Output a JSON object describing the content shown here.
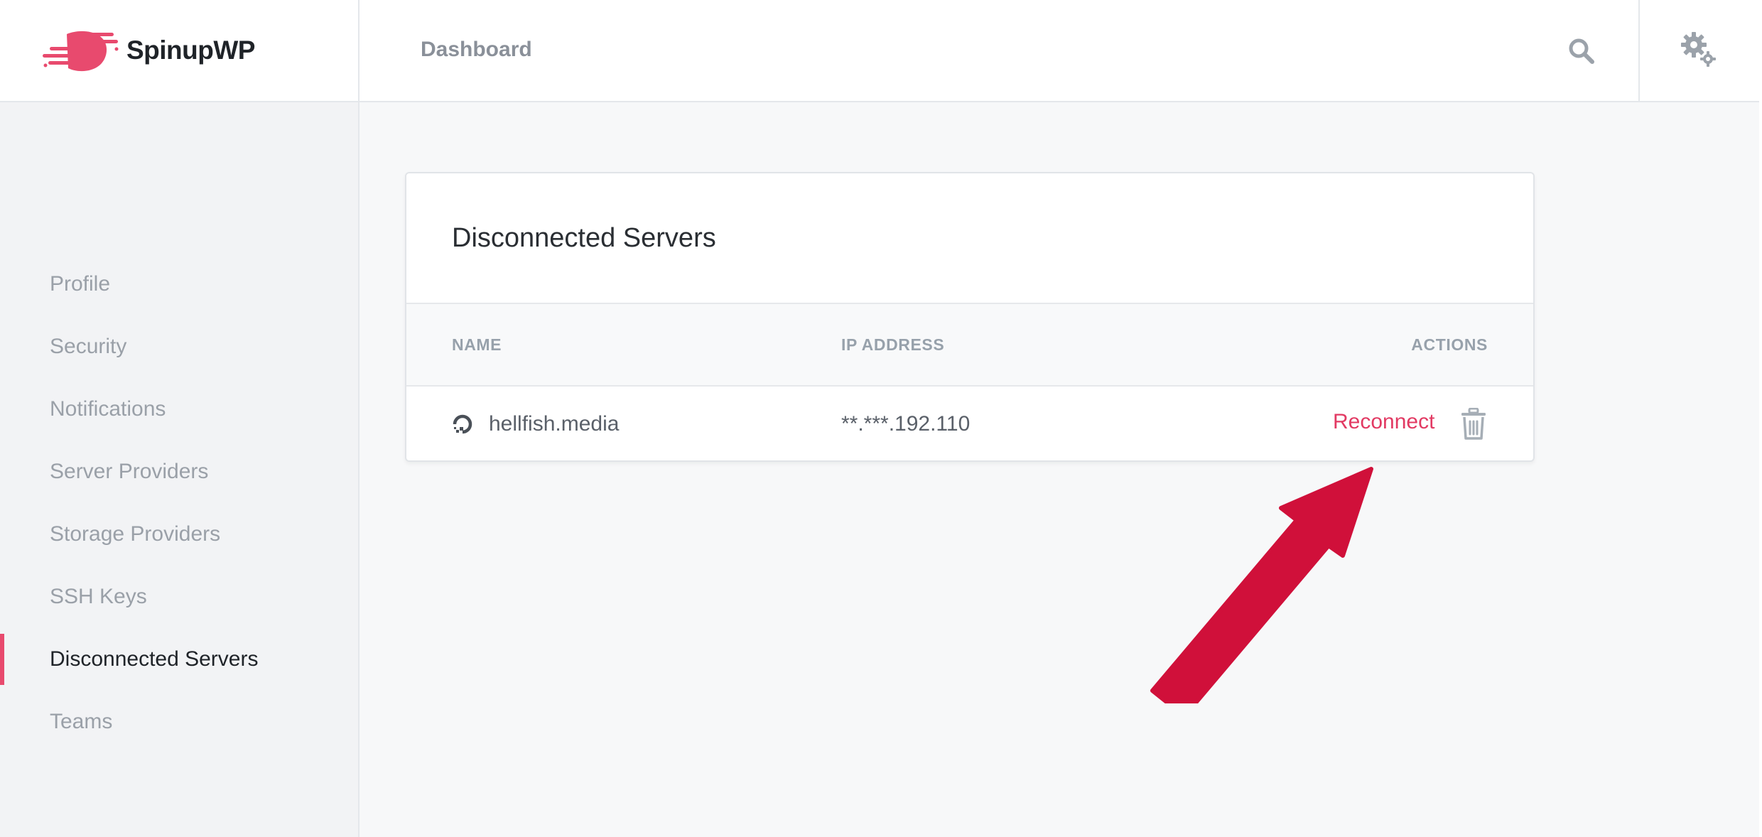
{
  "header": {
    "brand_name": "SpinupWP",
    "brand_color": "#e84a6e",
    "breadcrumb": "Dashboard",
    "search_icon": "search-icon",
    "settings_icon": "gears-icon"
  },
  "sidebar": {
    "items": [
      {
        "label": "Profile",
        "active": false
      },
      {
        "label": "Security",
        "active": false
      },
      {
        "label": "Notifications",
        "active": false
      },
      {
        "label": "Server Providers",
        "active": false
      },
      {
        "label": "Storage Providers",
        "active": false
      },
      {
        "label": "SSH Keys",
        "active": false
      },
      {
        "label": "Disconnected Servers",
        "active": true
      },
      {
        "label": "Teams",
        "active": false
      }
    ]
  },
  "main": {
    "title": "Disconnected Servers",
    "table": {
      "columns": [
        "NAME",
        "IP ADDRESS",
        "ACTIONS"
      ],
      "rows": [
        {
          "provider_icon": "digitalocean-icon",
          "name": "hellfish.media",
          "ip": "**.***.192.110",
          "action_label": "Reconnect",
          "delete_icon": "trash-icon"
        }
      ]
    }
  },
  "annotation": {
    "type": "arrow",
    "color": "#d0103a",
    "points_to": "Reconnect"
  }
}
